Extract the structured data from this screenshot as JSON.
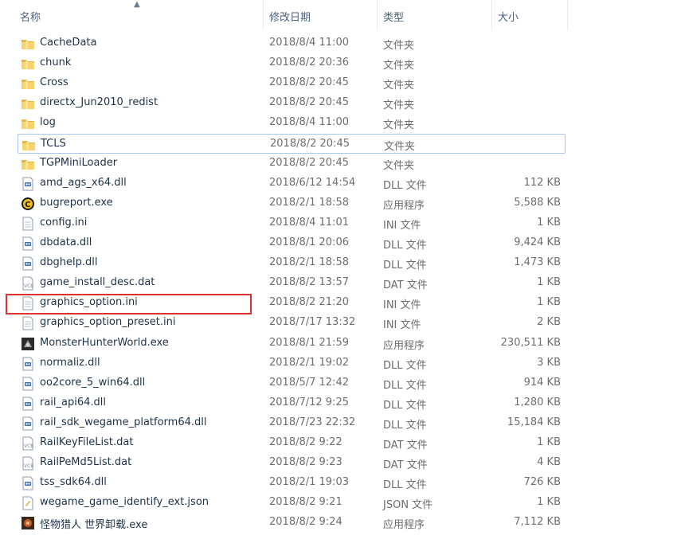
{
  "columns": {
    "name": "名称",
    "date": "修改日期",
    "type": "类型",
    "size": "大小"
  },
  "files": [
    {
      "name": "CacheData",
      "date": "2018/8/4 11:00",
      "type": "文件夹",
      "size": "",
      "icon": "folder-icon"
    },
    {
      "name": "chunk",
      "date": "2018/8/2 20:36",
      "type": "文件夹",
      "size": "",
      "icon": "folder-icon"
    },
    {
      "name": "Cross",
      "date": "2018/8/2 20:45",
      "type": "文件夹",
      "size": "",
      "icon": "folder-icon"
    },
    {
      "name": "directx_Jun2010_redist",
      "date": "2018/8/2 20:45",
      "type": "文件夹",
      "size": "",
      "icon": "folder-icon"
    },
    {
      "name": "log",
      "date": "2018/8/4 11:00",
      "type": "文件夹",
      "size": "",
      "icon": "folder-icon"
    },
    {
      "name": "TCLS",
      "date": "2018/8/2 20:45",
      "type": "文件夹",
      "size": "",
      "icon": "folder-icon"
    },
    {
      "name": "TGPMiniLoader",
      "date": "2018/8/2 20:45",
      "type": "文件夹",
      "size": "",
      "icon": "folder-icon"
    },
    {
      "name": "amd_ags_x64.dll",
      "date": "2018/6/12 14:54",
      "type": "DLL 文件",
      "size": "112 KB",
      "icon": "dll-file-icon"
    },
    {
      "name": "bugreport.exe",
      "date": "2018/2/1 18:58",
      "type": "应用程序",
      "size": "5,588 KB",
      "icon": "bugreport-app-icon"
    },
    {
      "name": "config.ini",
      "date": "2018/8/4 11:01",
      "type": "INI 文件",
      "size": "1 KB",
      "icon": "ini-file-icon"
    },
    {
      "name": "dbdata.dll",
      "date": "2018/8/1 20:06",
      "type": "DLL 文件",
      "size": "9,424 KB",
      "icon": "dll-file-icon"
    },
    {
      "name": "dbghelp.dll",
      "date": "2018/2/1 18:58",
      "type": "DLL 文件",
      "size": "1,473 KB",
      "icon": "dll-file-icon"
    },
    {
      "name": "game_install_desc.dat",
      "date": "2018/8/2 13:57",
      "type": "DAT 文件",
      "size": "1 KB",
      "icon": "dat-file-icon"
    },
    {
      "name": "graphics_option.ini",
      "date": "2018/8/2 21:20",
      "type": "INI 文件",
      "size": "1 KB",
      "icon": "ini-file-icon"
    },
    {
      "name": "graphics_option_preset.ini",
      "date": "2018/7/17 13:32",
      "type": "INI 文件",
      "size": "2 KB",
      "icon": "ini-file-icon"
    },
    {
      "name": "MonsterHunterWorld.exe",
      "date": "2018/8/1 21:59",
      "type": "应用程序",
      "size": "230,511 KB",
      "icon": "monster-hunter-app-icon"
    },
    {
      "name": "normaliz.dll",
      "date": "2018/2/1 19:02",
      "type": "DLL 文件",
      "size": "3 KB",
      "icon": "dll-file-icon"
    },
    {
      "name": "oo2core_5_win64.dll",
      "date": "2018/5/7 12:42",
      "type": "DLL 文件",
      "size": "914 KB",
      "icon": "dll-file-icon"
    },
    {
      "name": "rail_api64.dll",
      "date": "2018/7/12 9:25",
      "type": "DLL 文件",
      "size": "1,280 KB",
      "icon": "dll-file-icon"
    },
    {
      "name": "rail_sdk_wegame_platform64.dll",
      "date": "2018/7/23 22:32",
      "type": "DLL 文件",
      "size": "15,184 KB",
      "icon": "dll-file-icon"
    },
    {
      "name": "RailKeyFileList.dat",
      "date": "2018/8/2 9:22",
      "type": "DAT 文件",
      "size": "1 KB",
      "icon": "dat-file-icon"
    },
    {
      "name": "RailPeMd5List.dat",
      "date": "2018/8/2 9:23",
      "type": "DAT 文件",
      "size": "4 KB",
      "icon": "dat-file-icon"
    },
    {
      "name": "tss_sdk64.dll",
      "date": "2018/2/1 19:03",
      "type": "DLL 文件",
      "size": "726 KB",
      "icon": "dll-file-icon"
    },
    {
      "name": "wegame_game_identify_ext.json",
      "date": "2018/8/2 9:21",
      "type": "JSON 文件",
      "size": "1 KB",
      "icon": "json-file-icon"
    },
    {
      "name": "怪物猎人 世界卸载.exe",
      "date": "2018/8/2 9:24",
      "type": "应用程序",
      "size": "7,112 KB",
      "icon": "uninstaller-app-icon"
    }
  ],
  "focused_row": "TCLS",
  "highlighted_row": "graphics_option.ini"
}
